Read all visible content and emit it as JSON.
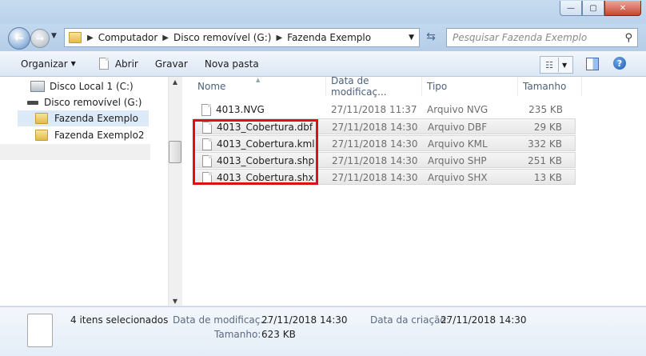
{
  "window": {
    "controls": {
      "minimize": "—",
      "maximize": "▢",
      "close": "✕"
    }
  },
  "address": {
    "segments": [
      "Computador",
      "Disco removível (G:)",
      "Fazenda Exemplo"
    ]
  },
  "search": {
    "placeholder": "Pesquisar Fazenda Exemplo"
  },
  "toolbar": {
    "organize": "Organizar",
    "open": "Abrir",
    "burn": "Gravar",
    "new_folder": "Nova pasta"
  },
  "nav": {
    "items": [
      {
        "label": "Disco Local 1 (C:)",
        "icon": "hard-drive-icon"
      },
      {
        "label": "Disco removível (G:)",
        "icon": "removable-drive-icon"
      },
      {
        "label": "Fazenda Exemplo",
        "icon": "folder-icon"
      },
      {
        "label": "Fazenda Exemplo2",
        "icon": "folder-icon"
      }
    ]
  },
  "columns": {
    "name": "Nome",
    "date": "Data de modificaç...",
    "type": "Tipo",
    "size": "Tamanho"
  },
  "files": [
    {
      "name": "4013.NVG",
      "date": "27/11/2018 11:37",
      "type": "Arquivo NVG",
      "size": "235 KB"
    },
    {
      "name": "4013_Cobertura.dbf",
      "date": "27/11/2018 14:30",
      "type": "Arquivo DBF",
      "size": "29 KB"
    },
    {
      "name": "4013_Cobertura.kml",
      "date": "27/11/2018 14:30",
      "type": "Arquivo KML",
      "size": "332 KB"
    },
    {
      "name": "4013_Cobertura.shp",
      "date": "27/11/2018 14:30",
      "type": "Arquivo SHP",
      "size": "251 KB"
    },
    {
      "name": "4013_Cobertura.shx",
      "date": "27/11/2018 14:30",
      "type": "Arquivo SHX",
      "size": "13 KB"
    }
  ],
  "details": {
    "selection": "4 itens selecionados",
    "modified_label": "Data de modificaç...",
    "modified_value": "27/11/2018 14:30",
    "created_label": "Data da criação:",
    "created_value": "27/11/2018 14:30",
    "size_label": "Tamanho:",
    "size_value": "623 KB"
  },
  "colors": {
    "highlight": "#e01010",
    "selection": "#dceaf8"
  }
}
